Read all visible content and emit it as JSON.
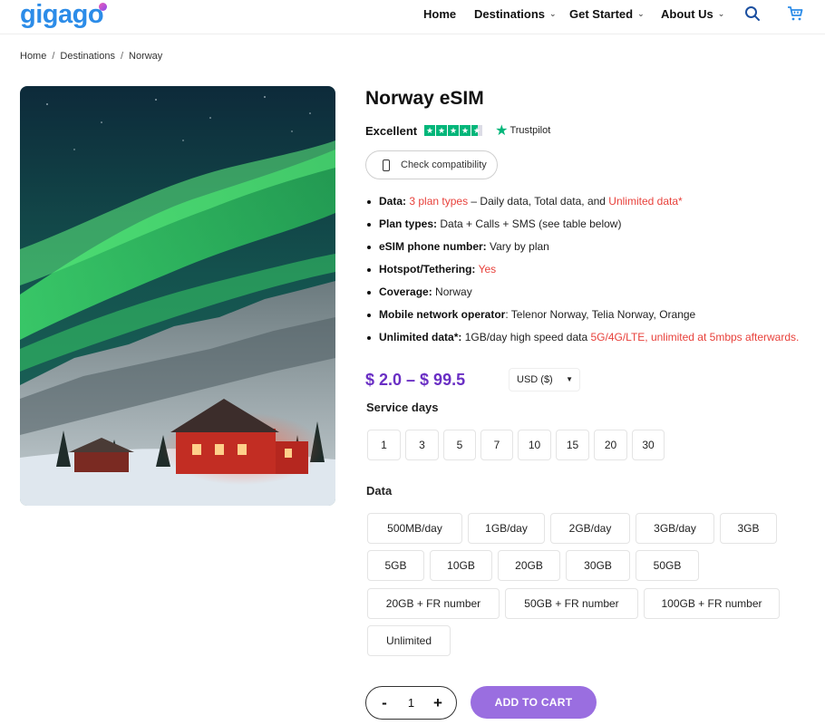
{
  "header": {
    "logo": "gigago",
    "nav": [
      {
        "label": "Home"
      },
      {
        "label": "Destinations"
      },
      {
        "label": "Get Started"
      },
      {
        "label": "About Us"
      }
    ],
    "icons": [
      "search-icon",
      "cart-icon"
    ]
  },
  "breadcrumb": [
    "Home",
    "Destinations",
    "Norway"
  ],
  "product": {
    "title": "Norway eSIM",
    "rating_word": "Excellent",
    "trustpilot": "Trustpilot",
    "stars": 4.5,
    "compat_label": "Check compatibility",
    "features": {
      "data_label": "Data:",
      "data_plan_types": "3 plan types",
      "data_dash": " – Daily data, Total data, and ",
      "data_unlimited": "Unlimited data*",
      "plan_types_label": "Plan types:",
      "plan_types_value": "Data + Calls + SMS (see table below)",
      "esim_number_label": "eSIM phone number:",
      "esim_number_value": "Vary by plan",
      "hotspot_label": "Hotspot/Tethering:",
      "hotspot_value": "Yes",
      "coverage_label": "Coverage:",
      "coverage_value": "Norway",
      "operator_label": "Mobile network operator",
      "operator_value": ": Telenor Norway, Telia Norway, Orange",
      "unlimited_label": "Unlimited data",
      "unlimited_star": "*",
      "unlimited_colon": ":",
      "unlimited_value": "1GB/day high speed data ",
      "unlimited_red": "5G/4G/LTE, unlimited at 5mbps afterwards."
    },
    "price": "$ 2.0 – $ 99.5",
    "currency": "USD ($)",
    "service_days_label": "Service days",
    "service_days": [
      "1",
      "3",
      "5",
      "7",
      "10",
      "15",
      "20",
      "30"
    ],
    "data_label": "Data",
    "data_options": [
      "500MB/day",
      "1GB/day",
      "2GB/day",
      "3GB/day",
      "3GB",
      "5GB",
      "10GB",
      "20GB",
      "30GB",
      "50GB",
      "20GB + FR number",
      "50GB + FR number",
      "100GB + FR number",
      "Unlimited"
    ],
    "quantity": "1",
    "qty_minus": "-",
    "qty_plus": "+",
    "add_to_cart": "ADD TO CART"
  },
  "colors": {
    "brand_blue": "#2c8ce8",
    "price_purple": "#6a2fc4",
    "button_purple": "#9a6ee0",
    "accent_red": "#e8413b",
    "trustpilot_green": "#00b67a"
  }
}
